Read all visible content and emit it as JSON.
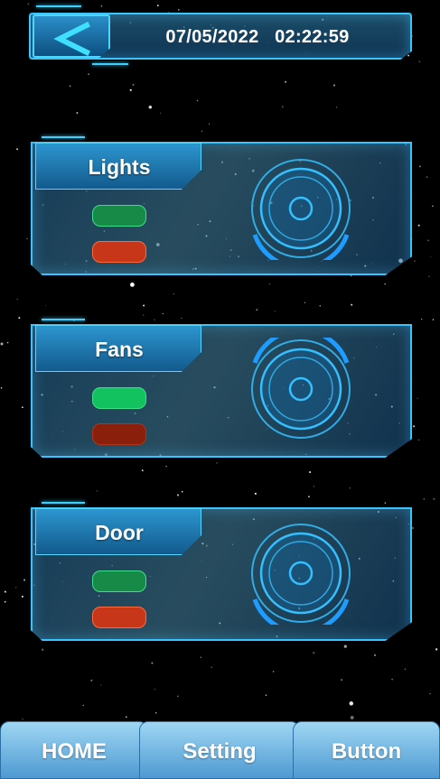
{
  "header": {
    "back_icon": "chevron-left-icon",
    "date": "07/05/2022",
    "time": "02:22:59"
  },
  "devices": [
    {
      "name": "Lights",
      "on_color": "#178a47",
      "off_color": "#c8361a",
      "active": "none",
      "ring_arc": "bottom"
    },
    {
      "name": "Fans",
      "on_color": "#12c25e",
      "off_color": "#8a1f0c",
      "active": "on",
      "ring_arc": "top"
    },
    {
      "name": "Door",
      "on_color": "#178a47",
      "off_color": "#c8361a",
      "active": "none",
      "ring_arc": "bottom"
    }
  ],
  "nav": {
    "home_label": "HOME",
    "setting_label": "Setting",
    "button_label": "Button"
  },
  "colors": {
    "accent": "#38c4ff",
    "nav_top": "#9fd6f3",
    "nav_bottom": "#4e9ad2"
  }
}
